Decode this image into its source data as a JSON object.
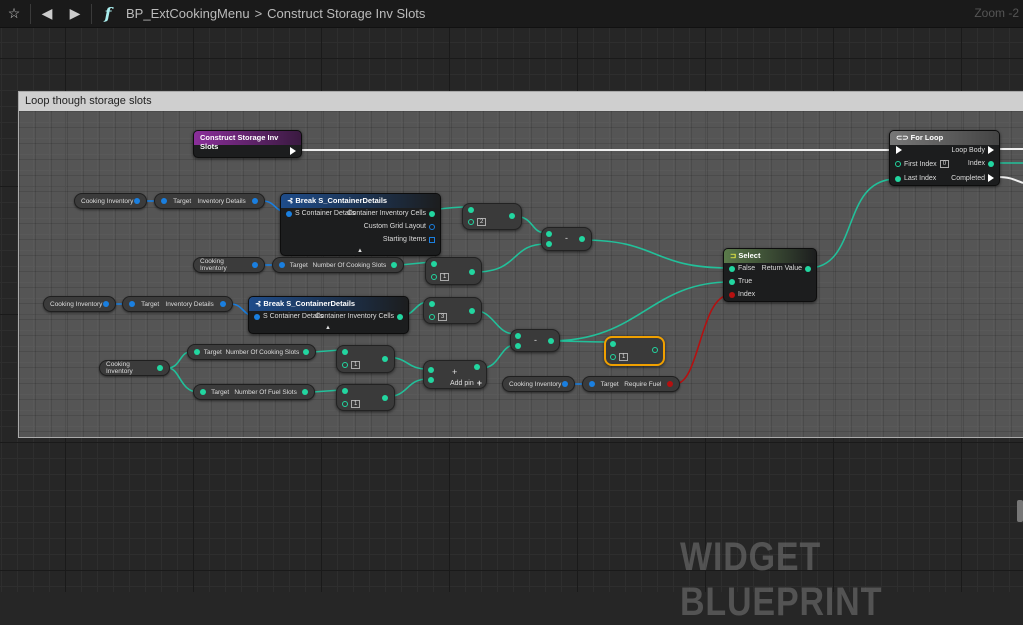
{
  "header": {
    "breadcrumb_root": "BP_ExtCookingMenu",
    "breadcrumb_sep": ">",
    "breadcrumb_current": "Construct Storage Inv Slots",
    "zoom": "Zoom -2",
    "icons": [
      "star-icon",
      "back-arrow-icon",
      "forward-arrow-icon",
      "function-icon"
    ],
    "function_glyph": "f"
  },
  "comment": {
    "title": "Loop though storage slots"
  },
  "nodes": {
    "entry": {
      "title": "Construct Storage Inv Slots"
    },
    "for_loop": {
      "title": "For Loop",
      "first_index": "First Index",
      "first_index_value": "0",
      "last_index": "Last Index",
      "loop_body": "Loop Body",
      "index": "Index",
      "completed": "Completed"
    },
    "break1": {
      "title": "Break S_ContainerDetails",
      "input": "S Container Details",
      "out1": "Container Inventory Cells",
      "out2": "Custom Grid Layout",
      "out3": "Starting Items"
    },
    "break2": {
      "title": "Break S_ContainerDetails",
      "input": "S Container Details",
      "out1": "Container Inventory Cells"
    },
    "select": {
      "title": "Select",
      "false": "False",
      "true": "True",
      "index": "Index",
      "return": "Return Value"
    },
    "add": {
      "label": "Add pin",
      "plus": "+"
    },
    "minus": "-",
    "subtract_values": [
      "2",
      "1",
      "3",
      "1",
      "1",
      "1"
    ]
  },
  "getters": {
    "cooking_inventory": "Cooking Inventory",
    "target": "Target",
    "inventory_details": "Inventory Details",
    "num_cooking_slots": "Number Of Cooking Slots",
    "num_fuel_slots": "Number Of Fuel Slots",
    "require_fuel": "Require Fuel"
  },
  "watermark": "WIDGET BLUEPRINT",
  "colors": {
    "int_pin": "#22d6a0",
    "struct_pin": "#1a7fe0",
    "bool_pin": "#b51010",
    "function_header": "#7a2a8a",
    "selected": "#f0a000"
  }
}
